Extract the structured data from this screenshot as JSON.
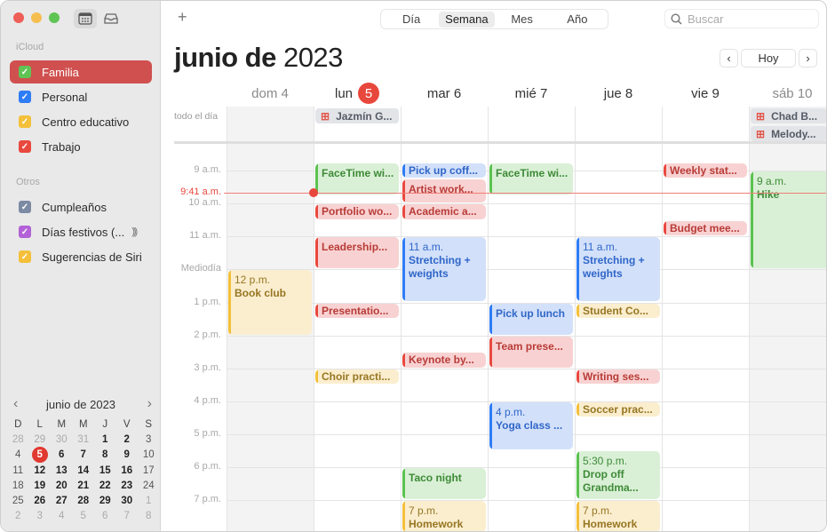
{
  "window": {
    "toolbar": {
      "add_label": "+",
      "search_placeholder": "Buscar"
    },
    "view_tabs": [
      {
        "label": "Día",
        "active": false
      },
      {
        "label": "Semana",
        "active": true
      },
      {
        "label": "Mes",
        "active": false
      },
      {
        "label": "Año",
        "active": false
      }
    ],
    "title_month": "junio de",
    "title_year": "2023",
    "nav": {
      "prev": "‹",
      "today": "Hoy",
      "next": "›"
    }
  },
  "sidebar": {
    "icons": [
      "calendar-icon",
      "inbox-icon"
    ],
    "sections": [
      {
        "label": "iCloud",
        "items": [
          {
            "label": "Familia",
            "color": "#5fc454",
            "selected": true
          },
          {
            "label": "Personal",
            "color": "#2e7cf6",
            "selected": false
          },
          {
            "label": "Centro educativo",
            "color": "#f4c03a",
            "selected": false
          },
          {
            "label": "Trabajo",
            "color": "#e9483e",
            "selected": false
          }
        ]
      },
      {
        "label": "Otros",
        "items": [
          {
            "label": "Cumpleaños",
            "color": "#7c8aa3",
            "selected": false
          },
          {
            "label": "Días festivos (...",
            "color": "#b261d6",
            "selected": false,
            "extra": "broadcast-icon"
          },
          {
            "label": "Sugerencias de Siri",
            "color": "#f4c03a",
            "selected": false
          }
        ]
      }
    ],
    "mini_calendar": {
      "title": "junio de 2023",
      "prev": "‹",
      "next": "›",
      "dow": [
        "D",
        "L",
        "M",
        "M",
        "J",
        "V",
        "S"
      ],
      "weeks": [
        [
          "28",
          "29",
          "30",
          "31",
          "1",
          "2",
          "3"
        ],
        [
          "4",
          "5",
          "6",
          "7",
          "8",
          "9",
          "10"
        ],
        [
          "11",
          "12",
          "13",
          "14",
          "15",
          "16",
          "17"
        ],
        [
          "18",
          "19",
          "20",
          "21",
          "22",
          "23",
          "24"
        ],
        [
          "25",
          "26",
          "27",
          "28",
          "29",
          "30",
          "1"
        ],
        [
          "2",
          "3",
          "4",
          "5",
          "6",
          "7",
          "8"
        ]
      ],
      "today": "5"
    }
  },
  "week": {
    "days": [
      {
        "label": "dom 4",
        "weekend": true
      },
      {
        "label": "lun",
        "badge": "5",
        "weekend": false
      },
      {
        "label": "mar 6",
        "weekend": false
      },
      {
        "label": "mié 7",
        "weekend": false
      },
      {
        "label": "jue 8",
        "weekend": false
      },
      {
        "label": "vie 9",
        "weekend": false
      },
      {
        "label": "sáb 10",
        "weekend": true
      }
    ],
    "all_day_label": "todo el día",
    "all_day_events": [
      {
        "day": 1,
        "row": 0,
        "title": "Jazmín G...",
        "icon": "gift-icon"
      },
      {
        "day": 6,
        "row": 0,
        "title": "Chad B...",
        "icon": "gift-icon"
      },
      {
        "day": 6,
        "row": 1,
        "title": "Melody...",
        "icon": "gift-icon"
      }
    ],
    "hour_labels": [
      "9 a.m.",
      "10 a.m.",
      "11 a.m.",
      "Mediodía",
      "1 p.m.",
      "2 p.m.",
      "3 p.m.",
      "4 p.m.",
      "5 p.m.",
      "6 p.m.",
      "7 p.m."
    ],
    "current_time": "9:41 a.m.",
    "events": [
      {
        "day": 1,
        "start": 8.75,
        "end": 9.75,
        "color": "green",
        "title": "FaceTime wi..."
      },
      {
        "day": 1,
        "start": 10.0,
        "end": 10.5,
        "color": "red",
        "title": "Portfolio wo..."
      },
      {
        "day": 1,
        "start": 11.0,
        "end": 12.0,
        "color": "red",
        "title": "Leadership..."
      },
      {
        "day": 1,
        "start": 13.0,
        "end": 13.5,
        "color": "red",
        "title": "Presentatio..."
      },
      {
        "day": 1,
        "start": 15.0,
        "end": 15.5,
        "color": "yellow",
        "title": "Choir practi..."
      },
      {
        "day": 2,
        "start": 8.75,
        "end": 9.25,
        "color": "blue",
        "title": "Pick up coff..."
      },
      {
        "day": 2,
        "start": 9.25,
        "end": 10.0,
        "color": "red",
        "title": "Artist work..."
      },
      {
        "day": 2,
        "start": 10.0,
        "end": 10.5,
        "color": "red",
        "title": "Academic a..."
      },
      {
        "day": 2,
        "start": 11.0,
        "end": 13.0,
        "color": "blue",
        "time": "11 a.m.",
        "title": "Stretching + weights"
      },
      {
        "day": 2,
        "start": 14.5,
        "end": 15.0,
        "color": "red",
        "title": "Keynote by..."
      },
      {
        "day": 2,
        "start": 18.0,
        "end": 19.0,
        "color": "green",
        "title": "Taco night"
      },
      {
        "day": 2,
        "start": 19.0,
        "end": 20.0,
        "color": "yellow",
        "time": "7 p.m.",
        "title": "Homework"
      },
      {
        "day": 3,
        "start": 8.75,
        "end": 9.75,
        "color": "green",
        "title": "FaceTime wi..."
      },
      {
        "day": 3,
        "start": 13.0,
        "end": 14.0,
        "color": "blue",
        "title": "Pick up lunch"
      },
      {
        "day": 3,
        "start": 14.0,
        "end": 15.0,
        "color": "red",
        "title": "Team prese..."
      },
      {
        "day": 3,
        "start": 16.0,
        "end": 17.5,
        "color": "blue",
        "time": "4 p.m.",
        "title": "Yoga class ..."
      },
      {
        "day": 4,
        "start": 11.0,
        "end": 13.0,
        "color": "blue",
        "time": "11 a.m.",
        "title": "Stretching + weights"
      },
      {
        "day": 4,
        "start": 13.0,
        "end": 13.5,
        "color": "yellow",
        "title": "Student Co..."
      },
      {
        "day": 4,
        "start": 15.0,
        "end": 15.5,
        "color": "red",
        "title": "Writing ses..."
      },
      {
        "day": 4,
        "start": 16.0,
        "end": 16.5,
        "color": "yellow",
        "title": "Soccer prac..."
      },
      {
        "day": 4,
        "start": 17.5,
        "end": 19.0,
        "color": "green",
        "time": "5:30 p.m.",
        "title": "Drop off Grandma..."
      },
      {
        "day": 4,
        "start": 19.0,
        "end": 20.0,
        "color": "yellow",
        "time": "7 p.m.",
        "title": "Homework"
      },
      {
        "day": 5,
        "start": 8.75,
        "end": 9.25,
        "color": "red",
        "title": "Weekly stat..."
      },
      {
        "day": 5,
        "start": 10.5,
        "end": 11.0,
        "color": "red",
        "title": "Budget mee..."
      },
      {
        "day": 6,
        "start": 9.0,
        "end": 12.0,
        "color": "green",
        "time": "9 a.m.",
        "title": "Hike"
      },
      {
        "day": 0,
        "start": 12.0,
        "end": 14.0,
        "color": "yellow",
        "time": "12 p.m.",
        "title": "Book club"
      }
    ]
  }
}
